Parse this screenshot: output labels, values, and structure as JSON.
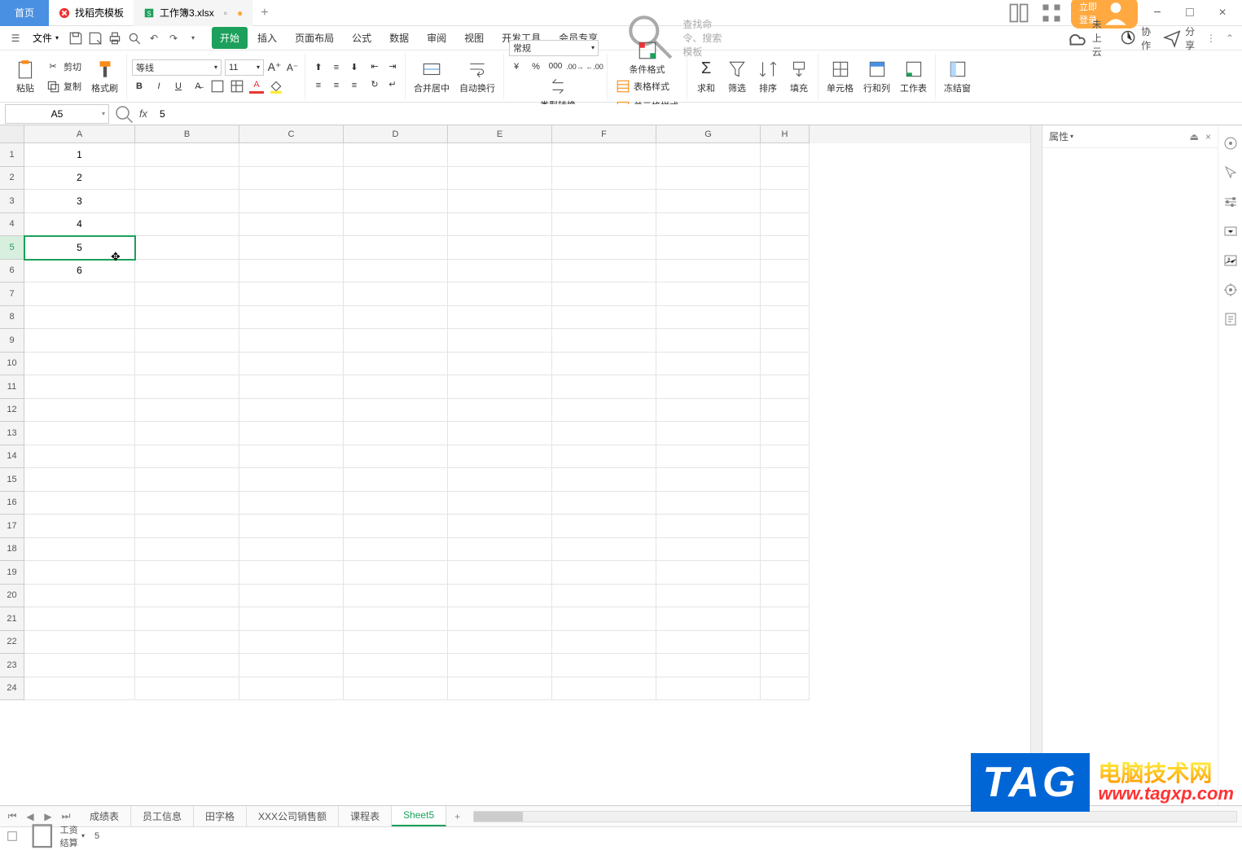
{
  "titlebar": {
    "home": "首页",
    "tab_templates": "找稻壳模板",
    "tab_workbook": "工作簿3.xlsx",
    "login": "立即登录"
  },
  "menubar": {
    "file": "文件",
    "tabs": [
      "开始",
      "插入",
      "页面布局",
      "公式",
      "数据",
      "审阅",
      "视图",
      "开发工具",
      "会员专享"
    ],
    "search_placeholder": "查找命令、搜索模板",
    "not_synced": "未上云",
    "collab": "协作",
    "share": "分享"
  },
  "ribbon": {
    "paste": "粘贴",
    "cut": "剪切",
    "copy": "复制",
    "format_painter": "格式刷",
    "font_name": "等线",
    "font_size": "11",
    "merge_center": "合并居中",
    "wrap_text": "自动换行",
    "number_format": "常规",
    "type_convert": "类型转换",
    "cond_format": "条件格式",
    "table_style": "表格样式",
    "cell_style": "单元格样式",
    "sum": "求和",
    "filter": "筛选",
    "sort": "排序",
    "fill": "填充",
    "cell": "单元格",
    "row_col": "行和列",
    "worksheet": "工作表",
    "freeze": "冻结窗"
  },
  "formula_bar": {
    "cell_ref": "A5",
    "formula_value": "5"
  },
  "columns": [
    "A",
    "B",
    "C",
    "D",
    "E",
    "F",
    "G",
    "H"
  ],
  "rows": [
    1,
    2,
    3,
    4,
    5,
    6,
    7,
    8,
    9,
    10,
    11,
    12,
    13,
    14,
    15,
    16,
    17,
    18,
    19,
    20,
    21,
    22,
    23,
    24
  ],
  "cell_data": {
    "A1": "1",
    "A2": "2",
    "A3": "3",
    "A4": "4",
    "A5": "5",
    "A6": "6"
  },
  "selected_cell": "A5",
  "right_panel": {
    "title": "属性"
  },
  "sheet_tabs": [
    "成绩表",
    "员工信息",
    "田字格",
    "XXX公司销售额",
    "课程表",
    "Sheet5"
  ],
  "active_sheet": "Sheet5",
  "status_bar": {
    "calc": "工资结算",
    "value": "5"
  },
  "watermark": {
    "tag": "TAG",
    "cn": "电脑技术网",
    "url": "www.tagxp.com"
  }
}
